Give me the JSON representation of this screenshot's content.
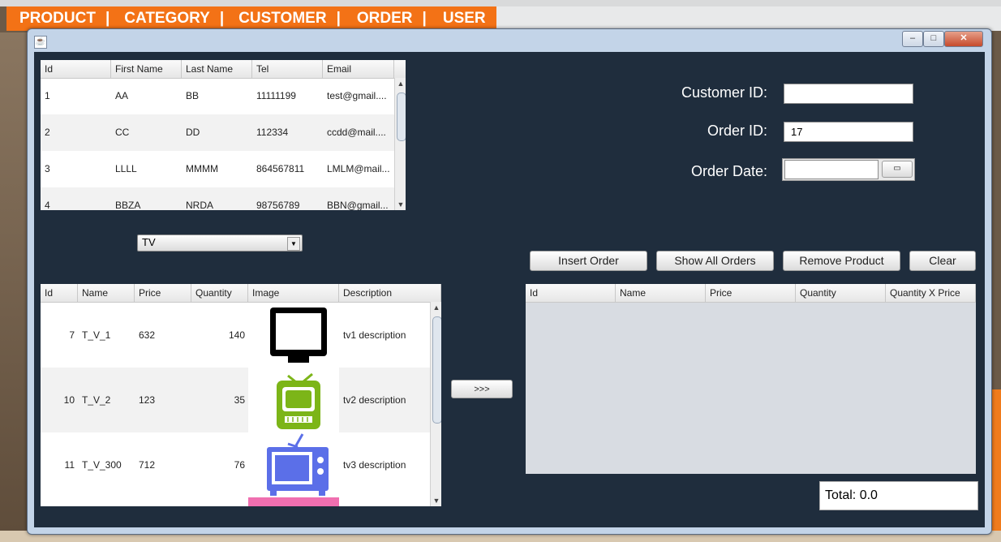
{
  "top_menu": {
    "items": [
      "PRODUCT",
      "CATEGORY",
      "CUSTOMER",
      "ORDER",
      "USER"
    ],
    "separator": "|"
  },
  "window": {
    "controls": {
      "minimize": "–",
      "maximize": "□",
      "close": "✕"
    }
  },
  "customers_table": {
    "columns": [
      "Id",
      "First Name",
      "Last Name",
      "Tel",
      "Email"
    ],
    "rows": [
      [
        "1",
        "AA",
        "BB",
        "11111199",
        "test@gmail...."
      ],
      [
        "2",
        "CC",
        "DD",
        "112334",
        "ccdd@mail...."
      ],
      [
        "3",
        "LLLL",
        "MMMM",
        "864567811",
        "LMLM@mail..."
      ],
      [
        "4",
        "BBZA",
        "NRDA",
        "98756789",
        "BBN@gmail..."
      ]
    ]
  },
  "category_combo": {
    "selected": "TV"
  },
  "products_table": {
    "columns": [
      "Id",
      "Name",
      "Price",
      "Quantity",
      "Image",
      "Description"
    ],
    "rows": [
      {
        "id": "7",
        "name": "T_V_1",
        "price": "632",
        "quantity": "140",
        "image": "tv-monitor-icon",
        "description": "tv1 description"
      },
      {
        "id": "10",
        "name": "T_V_2",
        "price": "123",
        "quantity": "35",
        "image": "retro-tv-green-icon",
        "description": "tv2 description"
      },
      {
        "id": "11",
        "name": "T_V_300",
        "price": "712",
        "quantity": "76",
        "image": "retro-tv-blue-icon",
        "description": "tv3 description"
      }
    ]
  },
  "add_button": {
    "label": ">>>"
  },
  "order_form": {
    "customer_id_label": "Customer ID:",
    "customer_id_value": "",
    "order_id_label": "Order ID:",
    "order_id_value": "17",
    "order_date_label": "Order Date:",
    "order_date_value": ""
  },
  "actions": {
    "insert_order": "Insert Order",
    "show_all_orders": "Show All Orders",
    "remove_product": "Remove Product",
    "clear": "Clear"
  },
  "order_items_table": {
    "columns": [
      "Id",
      "Name",
      "Price",
      "Quantity",
      "Quantity X Price"
    ],
    "rows": []
  },
  "total": {
    "text": "Total: 0.0"
  },
  "colors": {
    "menu_bar": "#f37216",
    "window_client": "#1f2d3d"
  }
}
